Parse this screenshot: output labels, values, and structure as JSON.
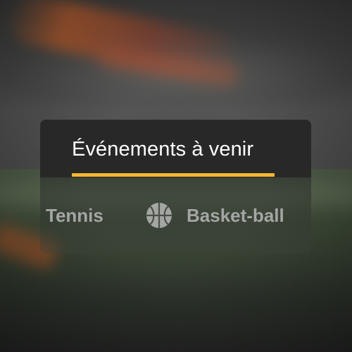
{
  "section": {
    "title": "Événements à venir",
    "accent_color": "#f5b72f"
  },
  "tabs": [
    {
      "label": "Tennis",
      "icon": null
    },
    {
      "label": "Basket-ball",
      "icon": "basketball-icon"
    }
  ],
  "colors": {
    "tab_text": "#a3a6a2",
    "card_header_bg": "#262626"
  }
}
